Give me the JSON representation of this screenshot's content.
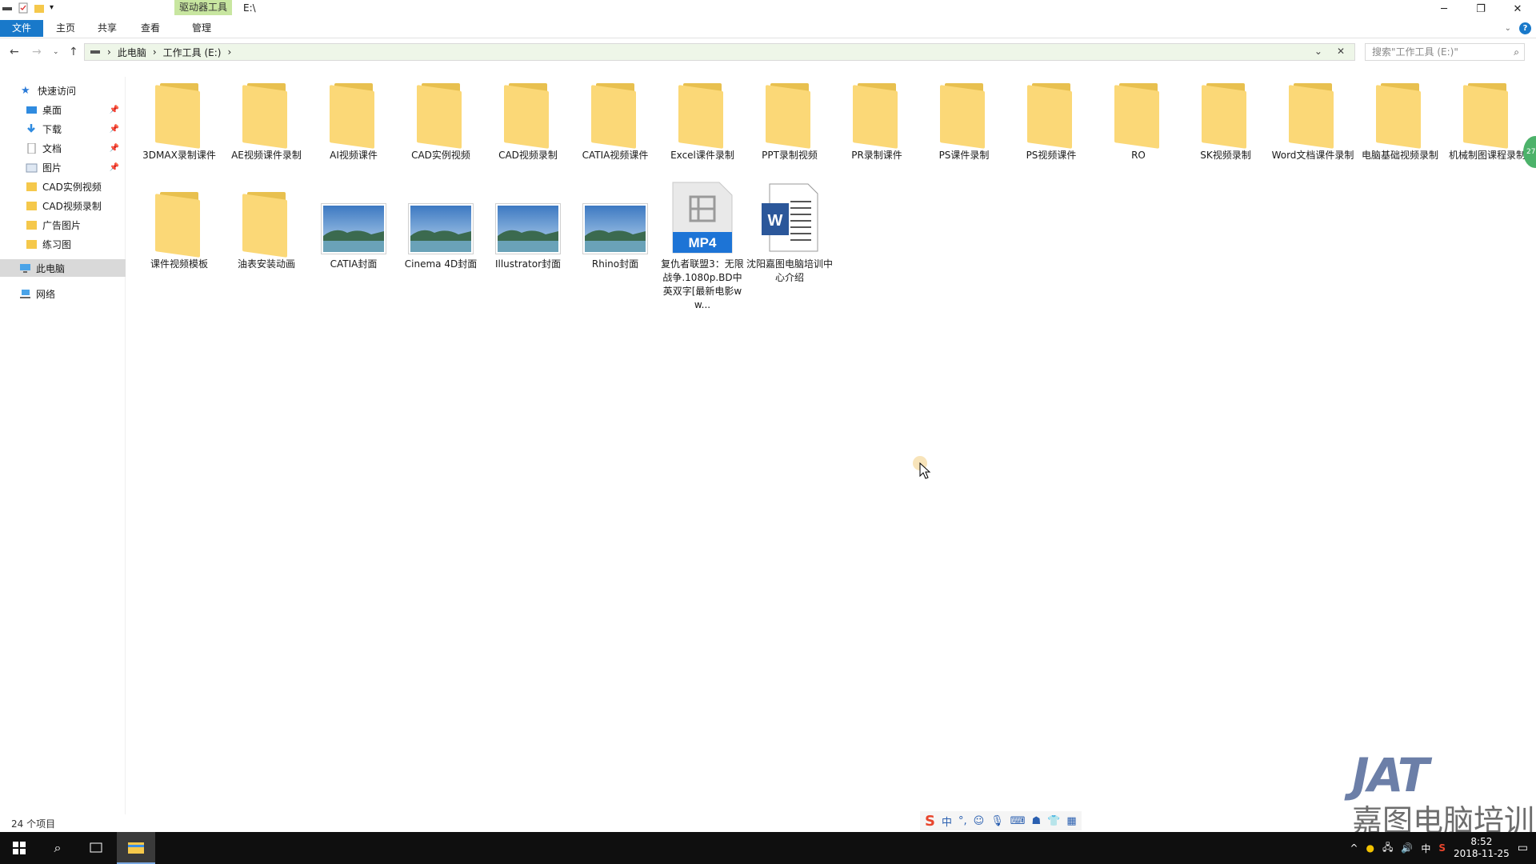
{
  "titlebar": {
    "context_tab": "驱动器工具",
    "path": "E:\\"
  },
  "ribbon": {
    "tabs": [
      "文件",
      "主页",
      "共享",
      "查看",
      "管理"
    ]
  },
  "address": {
    "crumbs": [
      "此电脑",
      "工作工具 (E:)"
    ],
    "search_placeholder": "搜索\"工作工具 (E:)\""
  },
  "nav": {
    "quick_access": "快速访问",
    "items": [
      {
        "label": "桌面",
        "icon": "desktop-icon",
        "pinned": true
      },
      {
        "label": "下载",
        "icon": "download-icon",
        "pinned": true
      },
      {
        "label": "文档",
        "icon": "document-icon",
        "pinned": true
      },
      {
        "label": "图片",
        "icon": "picture-icon",
        "pinned": true
      },
      {
        "label": "CAD实例视频",
        "icon": "folder-icon",
        "pinned": false
      },
      {
        "label": "CAD视频录制",
        "icon": "folder-icon",
        "pinned": false
      },
      {
        "label": "广告图片",
        "icon": "folder-icon",
        "pinned": false
      },
      {
        "label": "练习图",
        "icon": "folder-icon",
        "pinned": false
      }
    ],
    "this_pc": "此电脑",
    "network": "网络"
  },
  "files": [
    {
      "name": "3DMAX录制课件",
      "type": "folder"
    },
    {
      "name": "AE视频课件录制",
      "type": "folder"
    },
    {
      "name": "AI视频课件",
      "type": "folder"
    },
    {
      "name": "CAD实例视频",
      "type": "folder"
    },
    {
      "name": "CAD视频录制",
      "type": "folder"
    },
    {
      "name": "CATIA视频课件",
      "type": "folder"
    },
    {
      "name": "Excel课件录制",
      "type": "folder"
    },
    {
      "name": "PPT录制视频",
      "type": "folder"
    },
    {
      "name": "PR录制课件",
      "type": "folder"
    },
    {
      "name": "PS课件录制",
      "type": "folder"
    },
    {
      "name": "PS视频课件",
      "type": "folder"
    },
    {
      "name": "RO",
      "type": "folder"
    },
    {
      "name": "SK视频录制",
      "type": "folder"
    },
    {
      "name": "Word文档课件录制",
      "type": "folder"
    },
    {
      "name": "电脑基础视频录制",
      "type": "folder"
    },
    {
      "name": "机械制图课程录制",
      "type": "folder"
    },
    {
      "name": "课件视频模板",
      "type": "folder"
    },
    {
      "name": "油表安装动画",
      "type": "folder"
    },
    {
      "name": "CATIA封面",
      "type": "image"
    },
    {
      "name": "Cinema 4D封面",
      "type": "image"
    },
    {
      "name": "Illustrator封面",
      "type": "image"
    },
    {
      "name": "Rhino封面",
      "type": "image"
    },
    {
      "name": "复仇者联盟3：无限战争.1080p.BD中英双字[最新电影ww...",
      "type": "mp4",
      "badge": "MP4"
    },
    {
      "name": "沈阳嘉图电脑培训中心介绍",
      "type": "word",
      "badge": "W"
    }
  ],
  "status": {
    "item_count": "24 个项目"
  },
  "ime": {
    "mode": "中"
  },
  "watermark": {
    "brand": "JAT",
    "subtitle": "嘉图电脑培训"
  },
  "taskbar": {
    "tray_lang": "中",
    "time": "8:52",
    "date": "2018-11-25"
  },
  "colors": {
    "accent": "#1979ca",
    "folder": "#fbd877",
    "address_bg": "#eef6e8",
    "context_tab_bg": "#c8e6a0"
  }
}
